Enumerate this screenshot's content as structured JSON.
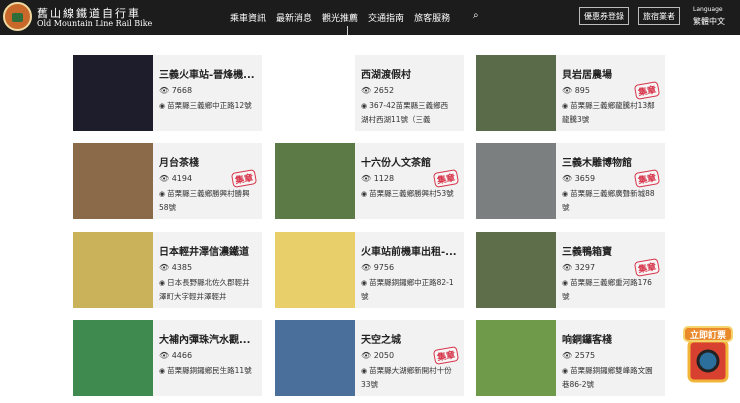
{
  "header": {
    "brand_zh": "舊山線鐵道自行車",
    "brand_en": "Old Mountain Line Rail Bike",
    "nav": [
      "乘車資訊",
      "最新消息",
      "觀光推薦",
      "交通指南",
      "旅客服務"
    ],
    "coupon_btn": "優惠券登錄",
    "hotel_btn": "旅宿業者",
    "language_label": "Language",
    "language_value": "繁體中文"
  },
  "stamp_label": "集章",
  "ticket_label": "立即訂票",
  "cards": [
    {
      "title": "三義火車站-晉烽機...",
      "views": "7668",
      "address": "苗栗縣三義鄉中正路12號",
      "stamp": false,
      "color": "#1d1d2b"
    },
    {
      "title": "西湖渡假村",
      "views": "2652",
      "address": "367-42苗栗縣三義鄉西湖村西湖11號（三義",
      "stamp": false,
      "color": "#fff"
    },
    {
      "title": "貝岩居農場",
      "views": "895",
      "address": "苗栗縣三義鄉龍騰村13鄰龍騰3號",
      "stamp": true,
      "color": "#5a6b4a"
    },
    {
      "title": "月台茶棧",
      "views": "4194",
      "address": "苗栗縣三義鄉勝興村勝興58號",
      "stamp": true,
      "color": "#8a6a48"
    },
    {
      "title": "十六份人文茶館",
      "views": "1128",
      "address": "苗栗縣三義鄉勝興村53號",
      "stamp": true,
      "color": "#5b7a45"
    },
    {
      "title": "三義木雕博物館",
      "views": "3659",
      "address": "苗栗縣三義鄉廣聲新城88號",
      "stamp": true,
      "color": "#7c7f80"
    },
    {
      "title": "日本輕井澤信濃鐵道",
      "views": "4385",
      "address": "日本長野縣北佐久郡輕井澤町大字輕井澤輕井",
      "stamp": false,
      "color": "#c9b25a"
    },
    {
      "title": "火車站前機車出租-...",
      "views": "9756",
      "address": "苗栗縣銅鑼鄉中正路82-1號",
      "stamp": false,
      "color": "#e8cf6a"
    },
    {
      "title": "三義鴨箱寶",
      "views": "3297",
      "address": "苗栗縣三義鄉重河路176號",
      "stamp": true,
      "color": "#5e6e4a"
    },
    {
      "title": "大補內彈珠汽水觀...",
      "views": "4466",
      "address": "苗栗縣銅鑼鄉民生路11號",
      "stamp": false,
      "color": "#3f8a4e"
    },
    {
      "title": "天空之城",
      "views": "2050",
      "address": "苗栗縣大湖鄉新開村十份33號",
      "stamp": true,
      "color": "#4a6f9a"
    },
    {
      "title": "响銅鑼客棧",
      "views": "2575",
      "address": "苗栗縣銅鑼鄉雙峰路文園巷86-2號",
      "stamp": false,
      "color": "#6f9a4a"
    }
  ]
}
